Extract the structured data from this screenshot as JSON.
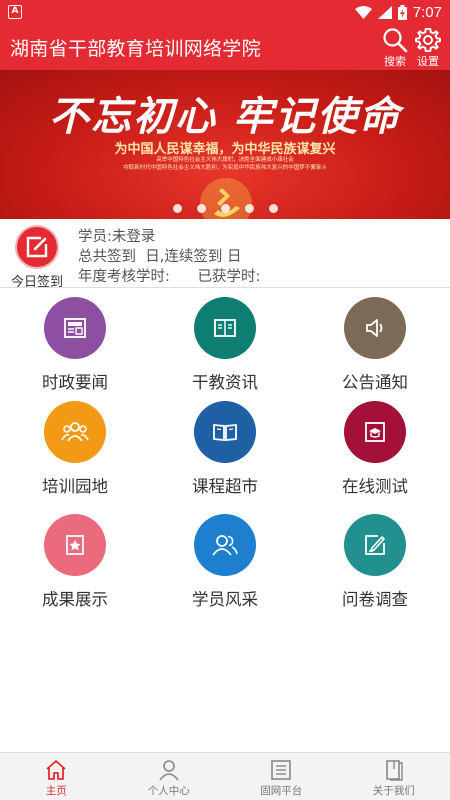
{
  "status_bar": {
    "app_badge": "A",
    "time": "7:07",
    "icons": [
      "wifi-icon",
      "signal-icon",
      "battery-charging-icon"
    ]
  },
  "header": {
    "title": "湖南省干部教育培训网络学院",
    "search_label": "搜索",
    "settings_label": "设置"
  },
  "banner": {
    "slogan": "不忘初心 牢记使命",
    "subtitle": "为中国人民谋幸福，为中华民族谋复兴",
    "small_lines": [
      "高举中国特色社会主义伟大旗帜，决胜全面建成小康社会",
      "夺取新时代中国特色社会主义伟大胜利，为实现中华民族伟大复兴的中国梦不懈奋斗"
    ],
    "slide_count": 5,
    "active_slide": 0
  },
  "user_info": {
    "signin_label": "今日签到",
    "student_label": "学员:",
    "student_value": "未登录",
    "total_signin_label": "总共签到",
    "total_signin_unit": "日,",
    "continuous_signin_label": "连续签到",
    "continuous_signin_unit": "日",
    "annual_hours_label": "年度考核学时:",
    "earned_hours_label": "已获学时:"
  },
  "grid": [
    {
      "label": "时政要闻",
      "icon": "newspaper-icon",
      "color": "#8e4fa3"
    },
    {
      "label": "干教资讯",
      "icon": "document-icon",
      "color": "#0e7d72"
    },
    {
      "label": "公告通知",
      "icon": "speaker-icon",
      "color": "#7b6a56"
    },
    {
      "label": "培训园地",
      "icon": "group-icon",
      "color": "#f29a16"
    },
    {
      "label": "课程超市",
      "icon": "open-book-icon",
      "color": "#1f5fa4"
    },
    {
      "label": "在线测试",
      "icon": "graduation-cap-icon",
      "color": "#a31039"
    },
    {
      "label": "成果展示",
      "icon": "star-badge-icon",
      "color": "#ec6a7e"
    },
    {
      "label": "学员风采",
      "icon": "users-icon",
      "color": "#1d7fcd"
    },
    {
      "label": "问卷调查",
      "icon": "edit-form-icon",
      "color": "#21908f"
    }
  ],
  "bottom_nav": [
    {
      "label": "主页",
      "icon": "home-icon",
      "active": true
    },
    {
      "label": "个人中心",
      "icon": "person-icon",
      "active": false
    },
    {
      "label": "固网平台",
      "icon": "list-icon",
      "active": false
    },
    {
      "label": "关于我们",
      "icon": "info-book-icon",
      "active": false
    }
  ],
  "colors": {
    "brand_red": "#e42a33",
    "nav_active": "#e42a33",
    "nav_inactive": "#777777"
  }
}
